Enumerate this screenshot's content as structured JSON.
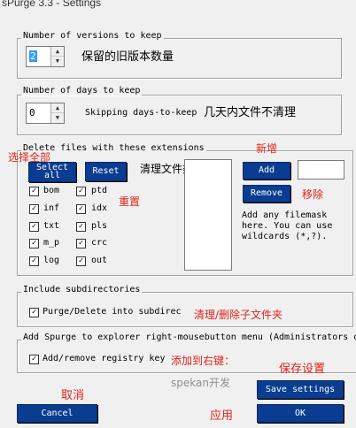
{
  "window": {
    "title": "sPurge 3.3 - Settings"
  },
  "versions": {
    "group_label": "Number of versions to keep",
    "value": "2",
    "annotation": "保留的旧版本数量"
  },
  "days": {
    "group_label": "Number of days to keep",
    "value": "0",
    "note": "Skipping days-to-keep",
    "annotation": "几天内文件不清理"
  },
  "extensions": {
    "group_label": "Delete files with these extensions",
    "select_all_line1": "Select",
    "select_all_line2": "all",
    "reset_label": "Reset",
    "annotation_select_all": "选择全部",
    "annotation_reset": "重置",
    "annotation_list": "清理文件类型",
    "annotation_add": "新增",
    "annotation_remove": "移除",
    "items": [
      {
        "label": "bom",
        "checked": true
      },
      {
        "label": "ptd",
        "checked": true
      },
      {
        "label": "inf",
        "checked": true
      },
      {
        "label": "idx",
        "checked": true
      },
      {
        "label": "txt",
        "checked": true
      },
      {
        "label": "pls",
        "checked": true
      },
      {
        "label": "m_p",
        "checked": true
      },
      {
        "label": "crc",
        "checked": true
      },
      {
        "label": "log",
        "checked": true
      },
      {
        "label": "out",
        "checked": true
      }
    ],
    "add_label": "Add",
    "remove_label": "Remove",
    "help_line1": "Add any filemask",
    "help_line2": "here. You can use",
    "help_line3": "wildcards (*,?)."
  },
  "subdirs": {
    "group_label": "Include subdirectories",
    "checkbox_label": "Purge/Delete into subdirec",
    "checked": true,
    "annotation": "清理/删除子文件夹"
  },
  "explorer": {
    "group_label": "Add Spurge to explorer right-mousebutton menu (Administrators o",
    "checkbox_label": "Add/remove registry key",
    "checked": true,
    "annotation": "添加到右键："
  },
  "footer": {
    "cancel_label": "Cancel",
    "save_label": "Save settings",
    "ok_label": "OK",
    "annotation_cancel": "取消",
    "annotation_save": "保存设置",
    "annotation_apply": "应用",
    "watermark_text": "spekan开发"
  },
  "colors": {
    "button_blue": "#0a3d91",
    "annotation_red": "#e2231a",
    "selection_blue": "#3399ff"
  }
}
